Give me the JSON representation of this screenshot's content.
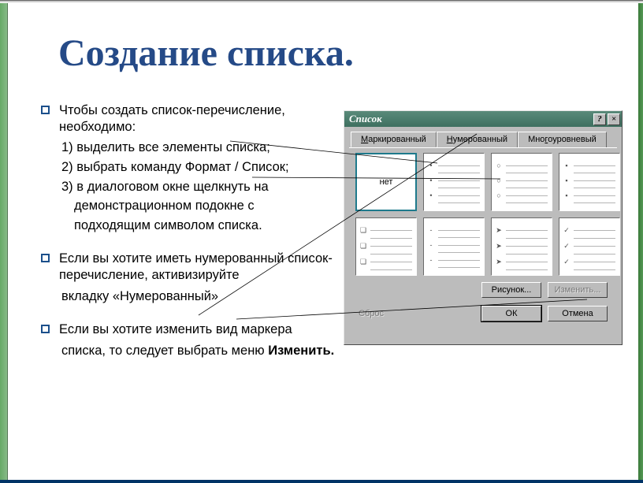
{
  "title": "Создание списка.",
  "bullets": [
    {
      "text": "Чтобы создать список-перечисление, необходимо:",
      "subs": [
        "1) выделить все элементы списка;",
        "2) выбрать команду Формат / Список;",
        "3) в диалоговом окне щелкнуть на"
      ],
      "subs2": [
        "демонстрационном подокне с",
        "подходящим символом списка."
      ]
    },
    {
      "text": "Если вы хотите иметь нумерованный список-перечисление, активизируйте",
      "tail": "вкладку «Нумерованный»"
    },
    {
      "text": "Если вы хотите изменить вид маркера",
      "tail": "списка, то следует выбрать меню Изменить."
    }
  ],
  "dialog": {
    "title": "Список",
    "help": "?",
    "close": "×",
    "tabs": [
      "Маркированный",
      "Нумерованный",
      "Многоуровневый"
    ],
    "none": "нет",
    "btn_image": "Рисунок...",
    "btn_change": "Изменить...",
    "btn_reset": "Сброс",
    "btn_ok": "ОК",
    "btn_cancel": "Отмена"
  },
  "cells": [
    {
      "selected": true,
      "none": true
    },
    {
      "mark": "•"
    },
    {
      "mark": "○"
    },
    {
      "mark": "▪"
    },
    {
      "mark": "❏"
    },
    {
      "mark": "-"
    },
    {
      "mark": "➤"
    },
    {
      "mark": "✓"
    }
  ]
}
